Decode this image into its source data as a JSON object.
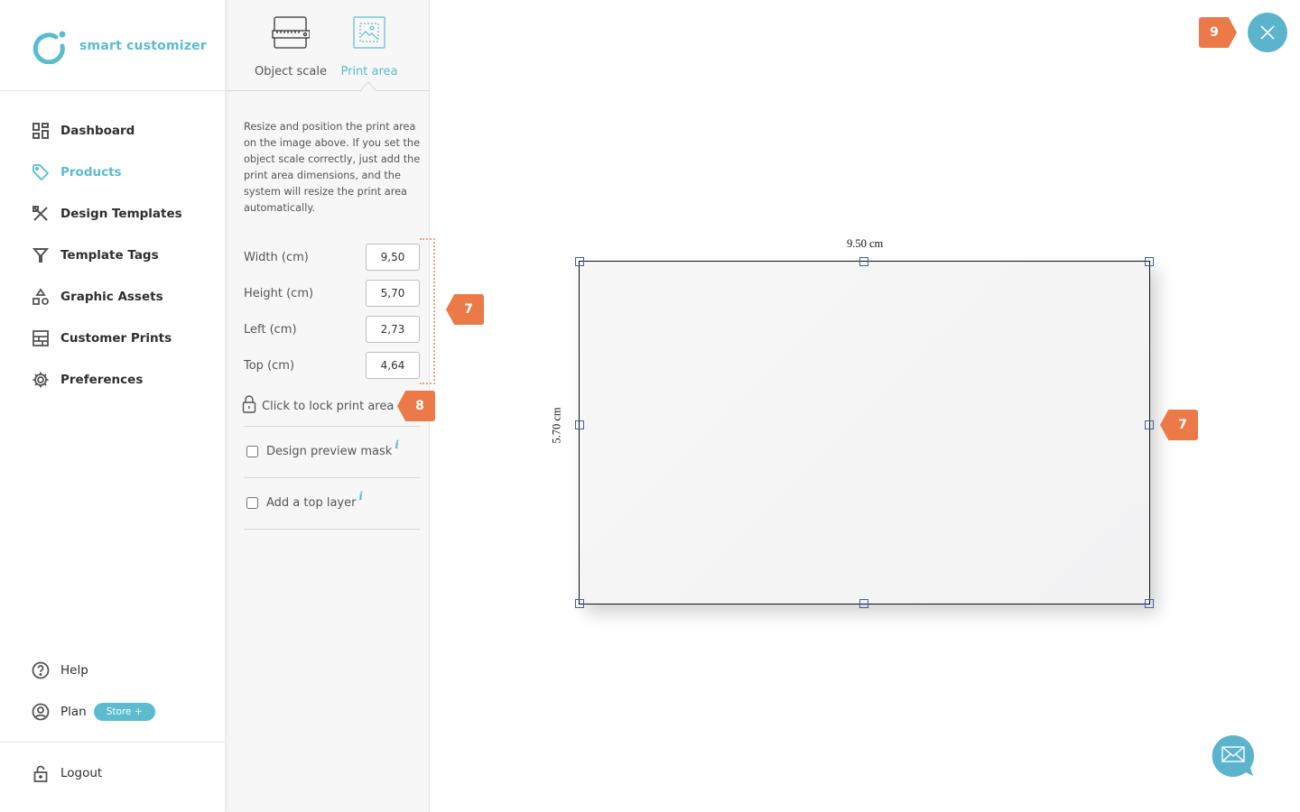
{
  "app": {
    "brand": "smart customizer",
    "brand_color": "#5bbccf",
    "accent_marker_color": "#ec7a48"
  },
  "sidebar": {
    "items": [
      {
        "label": "Dashboard",
        "icon": "dashboard-icon",
        "active": false
      },
      {
        "label": "Products",
        "icon": "tag-icon",
        "active": true
      },
      {
        "label": "Design Templates",
        "icon": "design-tools-icon",
        "active": false
      },
      {
        "label": "Template Tags",
        "icon": "filter-icon",
        "active": false
      },
      {
        "label": "Graphic Assets",
        "icon": "shapes-icon",
        "active": false
      },
      {
        "label": "Customer Prints",
        "icon": "prints-icon",
        "active": false
      },
      {
        "label": "Preferences",
        "icon": "gear-icon",
        "active": false
      }
    ],
    "bottom": {
      "help": "Help",
      "plan": "Plan",
      "plan_badge": "Store +",
      "logout": "Logout"
    }
  },
  "panel": {
    "tabs": [
      {
        "label": "Object scale",
        "icon": "ruler-icon",
        "active": false
      },
      {
        "label": "Print area",
        "icon": "print-area-icon",
        "active": true
      }
    ],
    "description": "Resize and position the print area on the image above. If you set the object scale correctly, just add the print area dimensions, and the system will resize the print area automatically.",
    "fields": [
      {
        "label": "Width (cm)",
        "value": "9,50"
      },
      {
        "label": "Height (cm)",
        "value": "5,70"
      },
      {
        "label": "Left (cm)",
        "value": "2,73"
      },
      {
        "label": "Top (cm)",
        "value": "4,64"
      }
    ],
    "lock_label": "Click to lock print area",
    "options": [
      {
        "label": "Design preview mask",
        "checked": false,
        "info": "i"
      },
      {
        "label": "Add a top layer",
        "checked": false,
        "info": "i"
      }
    ]
  },
  "canvas": {
    "width_label": "9.50 cm",
    "height_label": "5.70 cm"
  },
  "markers": {
    "fields_marker": "7",
    "lock_marker": "8",
    "canvas_marker": "7",
    "close_marker": "9"
  }
}
